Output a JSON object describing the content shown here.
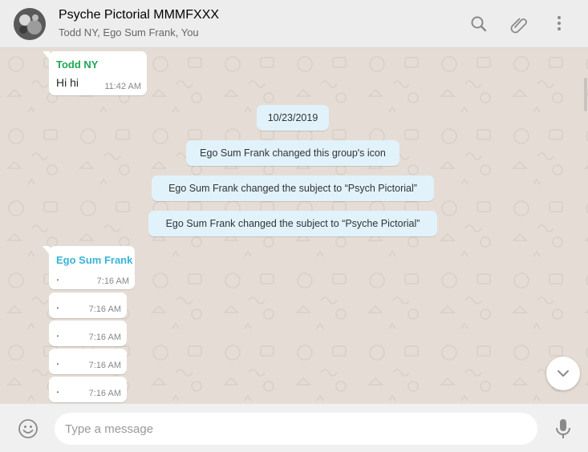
{
  "header": {
    "title": "Psyche Pictorial MMMFXXX",
    "participants": "Todd NY, Ego Sum Frank, You",
    "icons": [
      "search-icon",
      "attach-icon",
      "menu-icon"
    ]
  },
  "messages": {
    "todd": {
      "sender": "Todd NY",
      "sender_color": "#1fa855",
      "text": "Hi hi",
      "time": "11:42 AM"
    },
    "date_chip": "10/23/2019",
    "system": [
      "Ego Sum Frank changed this group's icon",
      "Ego Sum Frank changed the subject to “Psych Pictorial”",
      "Ego Sum Frank changed the subject to “Psyche Pictorial”"
    ],
    "frank": {
      "sender": "Ego Sum Frank",
      "sender_color": "#35b5d8",
      "items": [
        {
          "text": ".",
          "time": "7:16 AM"
        },
        {
          "text": ".",
          "time": "7:16 AM"
        },
        {
          "text": ".",
          "time": "7:16 AM"
        },
        {
          "text": ".",
          "time": "7:16 AM"
        },
        {
          "text": ".",
          "time": "7:16 AM"
        }
      ]
    }
  },
  "composer": {
    "placeholder": "Type a message",
    "icons": [
      "emoji-icon",
      "microphone-icon"
    ]
  },
  "colors": {
    "chat_background": "#e5ddd5",
    "system_bubble": "#e1f2fb",
    "header_background": "#ededed"
  }
}
